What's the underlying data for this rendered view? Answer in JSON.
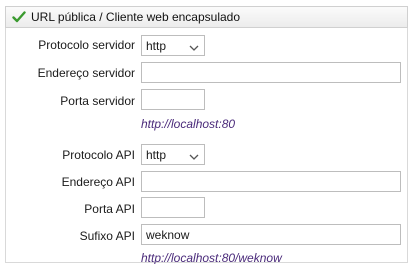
{
  "header": {
    "title": "URL pública / Cliente web encapsulado",
    "icon": "checkmark-icon"
  },
  "server": {
    "protocol_label": "Protocolo servidor",
    "protocol_value": "http",
    "address_label": "Endereço servidor",
    "address_value": "",
    "port_label": "Porta servidor",
    "port_value": "",
    "url_preview": "http://localhost:80"
  },
  "api": {
    "protocol_label": "Protocolo API",
    "protocol_value": "http",
    "address_label": "Endereço API",
    "address_value": "",
    "port_label": "Porta API",
    "port_value": "",
    "suffix_label": "Sufixo API",
    "suffix_value": "weknow",
    "url_preview": "http://localhost:80/weknow"
  },
  "colors": {
    "check_green": "#3a9a2f",
    "url_text": "#4a2a7a",
    "field_border": "#bdbdbd"
  }
}
